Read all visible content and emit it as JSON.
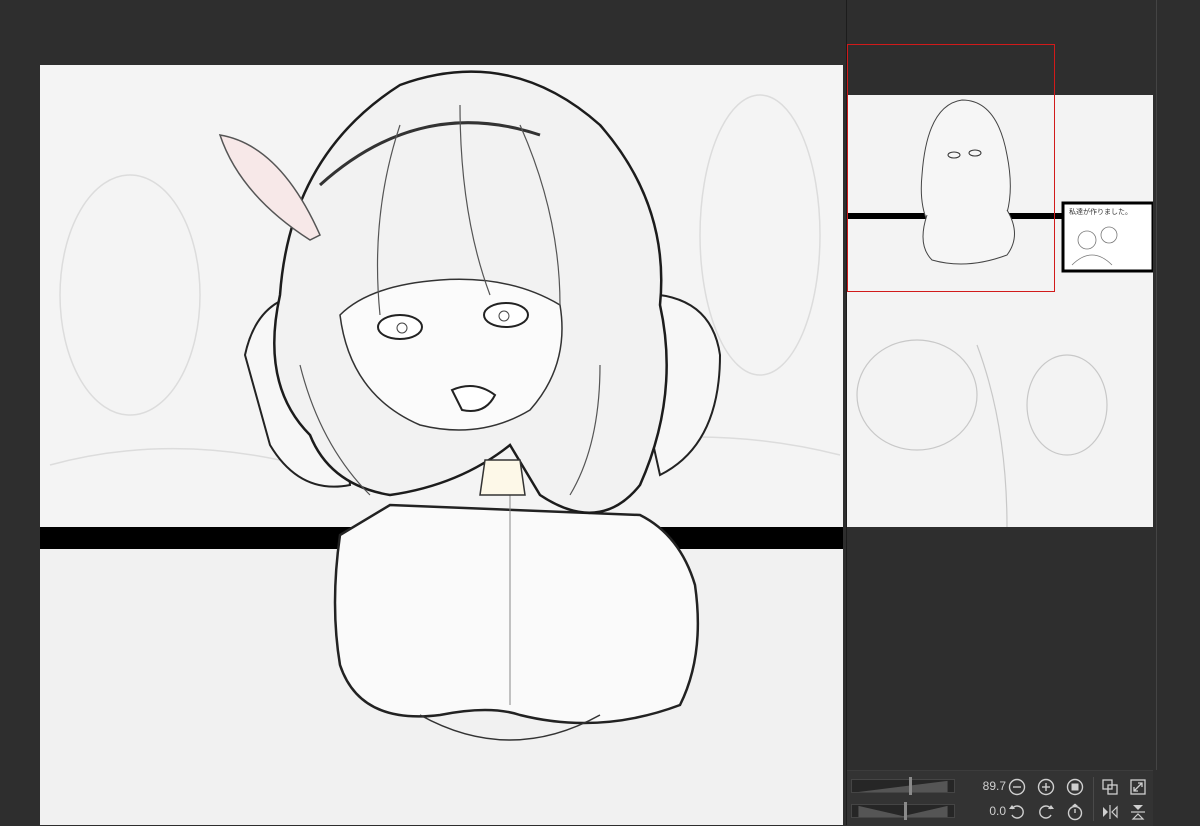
{
  "canvas": {
    "page_color": "#f4f4f4",
    "panel_border_color": "#000000"
  },
  "navigator": {
    "viewport_color": "#d11a1a",
    "thumbnail_caption": "私達が作りました。"
  },
  "toolbar": {
    "zoom_value": "89.7",
    "rotation_value": "0.0",
    "zoom_fraction": 0.55,
    "rotation_fraction": 0.5,
    "icons": {
      "zoom_out": "minus-circle-icon",
      "zoom_in": "plus-circle-icon",
      "fit": "stop-circle-icon",
      "fit_window": "fit-window-icon",
      "actual_size": "expand-icon",
      "rotate_left": "rotate-left-icon",
      "rotate_right": "rotate-right-icon",
      "reset_rotation": "reset-rotation-icon",
      "flip_horizontal": "flip-horizontal-icon",
      "flip_vertical": "flip-vertical-icon"
    }
  }
}
